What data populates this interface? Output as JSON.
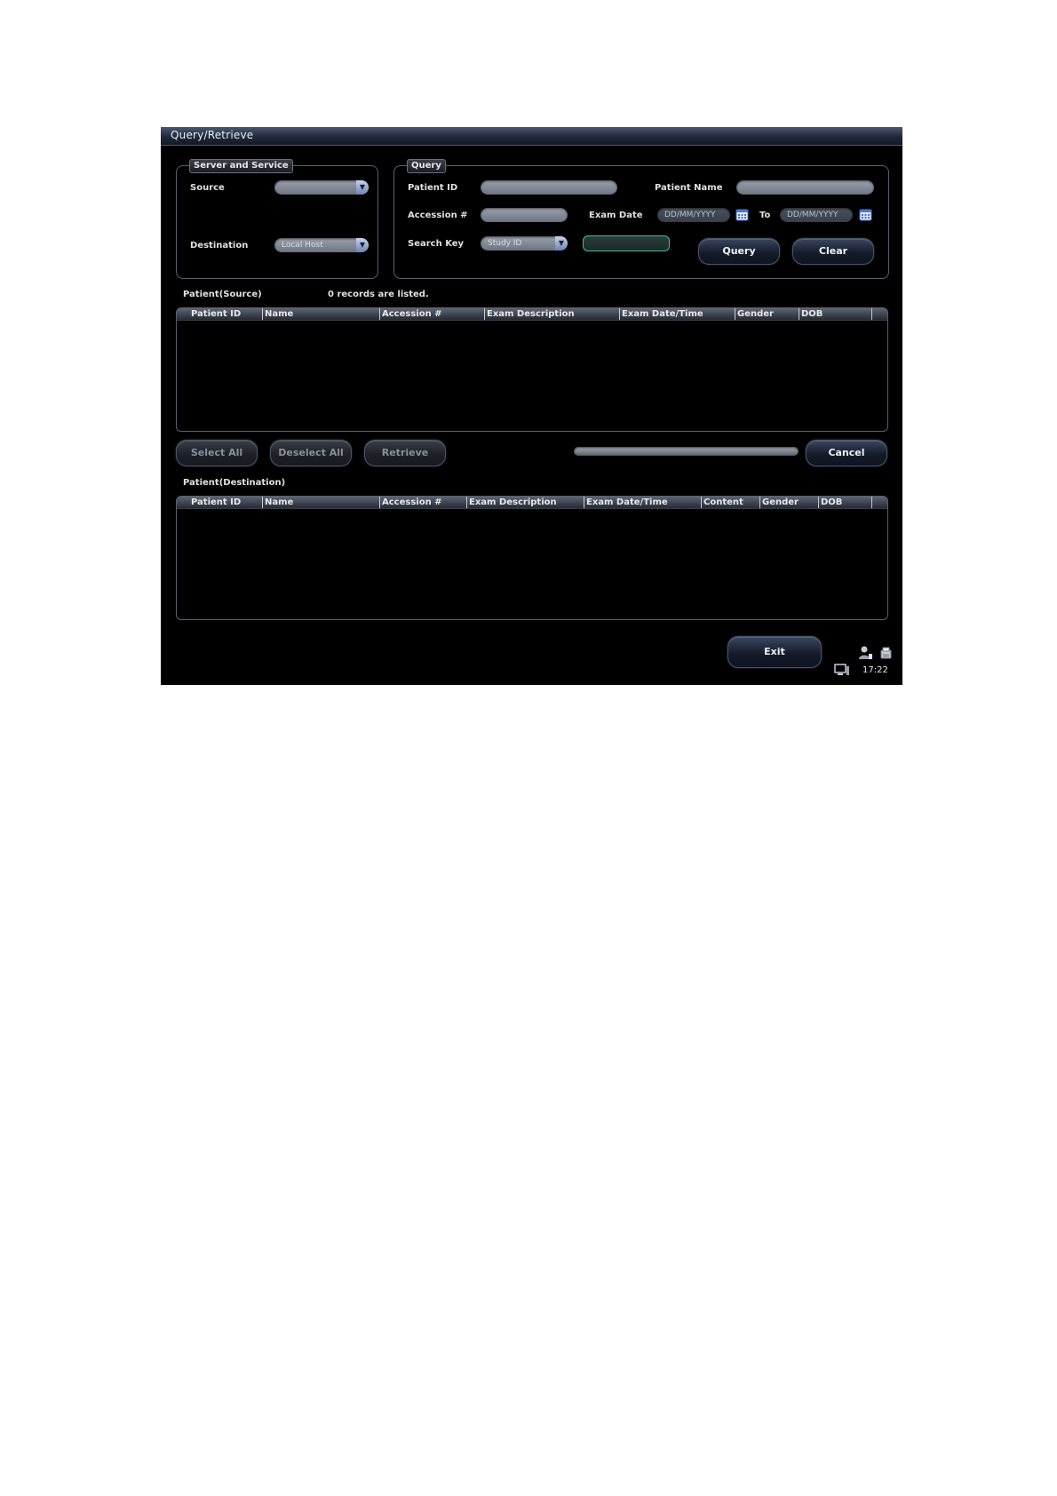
{
  "window": {
    "title": "Query/Retrieve"
  },
  "server": {
    "legend": "Server and Service",
    "source_label": "Source",
    "source_value": "",
    "destination_label": "Destination",
    "destination_value": "Local Host"
  },
  "query": {
    "legend": "Query",
    "patient_id_label": "Patient ID",
    "patient_id_value": "",
    "patient_name_label": "Patient Name",
    "patient_name_value": "",
    "accession_label": "Accession #",
    "accession_value": "",
    "exam_date_label": "Exam Date",
    "exam_date_from": "DD/MM/YYYY",
    "to_label": "To",
    "exam_date_to": "DD/MM/YYYY",
    "search_key_label": "Search Key",
    "search_key_value": "Study ID",
    "search_value": "",
    "query_button": "Query",
    "clear_button": "Clear"
  },
  "source_list": {
    "title": "Patient(Source)",
    "status": "0 records are listed.",
    "columns": [
      "Patient ID",
      "Name",
      "Accession #",
      "Exam Description",
      "Exam Date/Time",
      "Gender",
      "DOB"
    ],
    "rows": []
  },
  "actions": {
    "select_all": "Select All",
    "deselect_all": "Deselect All",
    "retrieve": "Retrieve",
    "cancel": "Cancel"
  },
  "destination_list": {
    "title": "Patient(Destination)",
    "columns": [
      "Patient ID",
      "Name",
      "Accession #",
      "Exam Description",
      "Exam Date/Time",
      "Content",
      "Gender",
      "DOB"
    ],
    "rows": []
  },
  "footer": {
    "exit_button": "Exit",
    "time": "17:22",
    "icons": [
      "user-icon",
      "printer-icon",
      "network-icon"
    ]
  }
}
